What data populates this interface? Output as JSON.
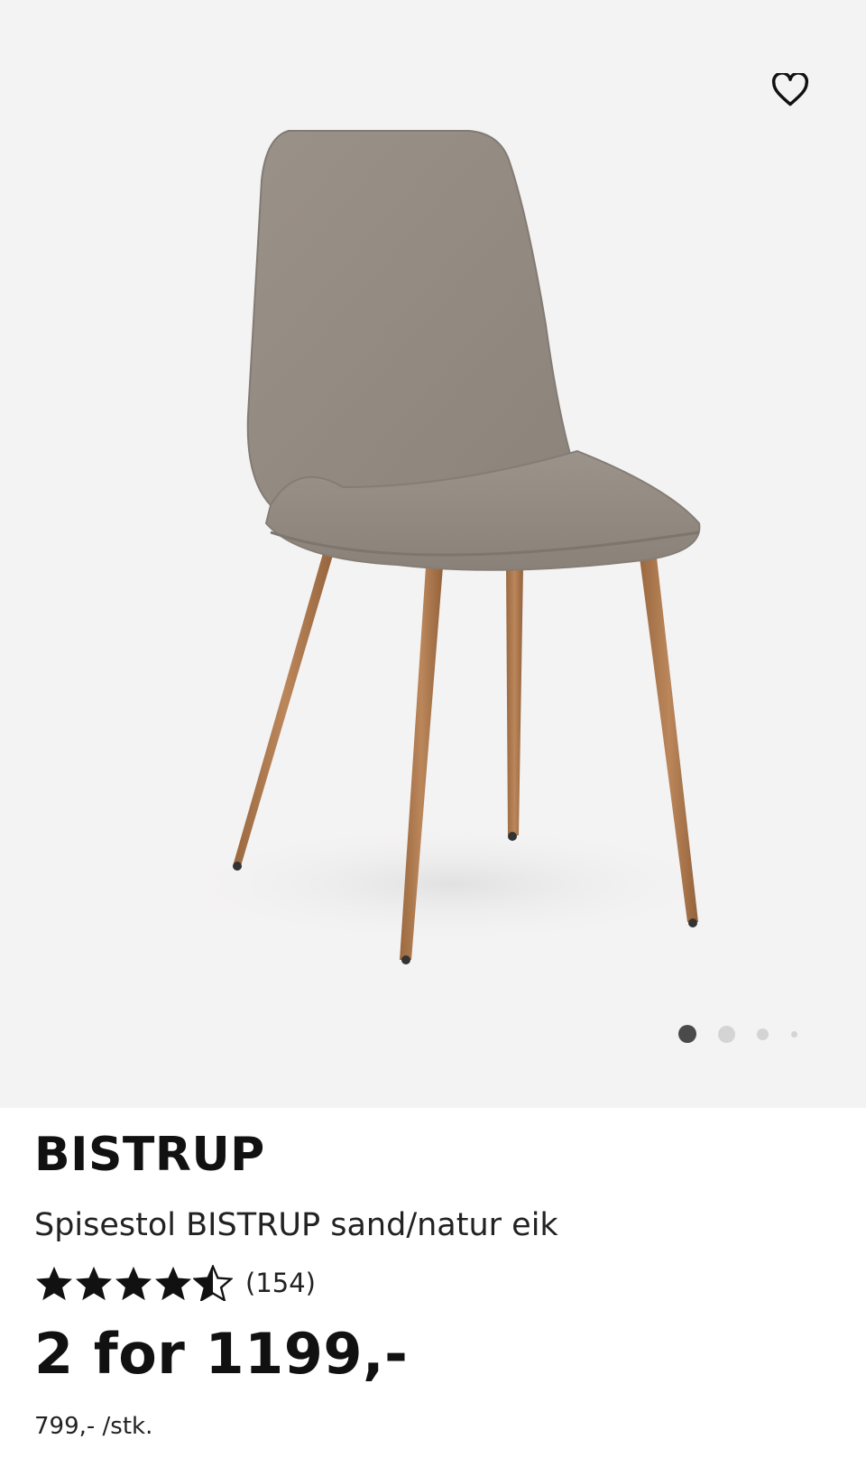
{
  "product": {
    "brand": "BISTRUP",
    "description": "Spisestol BISTRUP sand/natur eik",
    "rating": 4.5,
    "rating_max": 5,
    "review_count": "(154)",
    "price": "2 for 1199,-",
    "unit_price": "799,- /stk."
  },
  "gallery": {
    "image_count": 4,
    "active_index": 0,
    "favorite_icon": "heart-outline-icon"
  },
  "colors": {
    "gallery_bg": "#f4f3f3",
    "fabric": "#938a80",
    "wood_leg": "#b07a4f",
    "dot_active": "#4a4a4a",
    "dot_inactive": "#d4d4d4"
  }
}
